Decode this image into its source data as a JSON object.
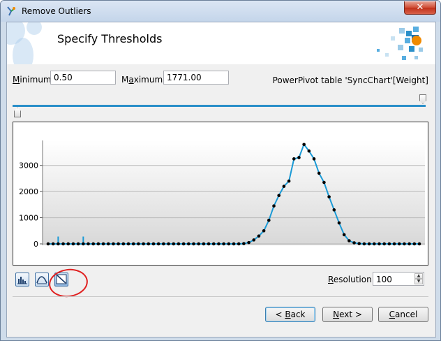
{
  "window": {
    "title": "Remove Outliers",
    "close_glyph": "✕"
  },
  "header": {
    "title": "Specify Thresholds"
  },
  "fields": {
    "minimum": {
      "label_key": "M",
      "label_rest": "inimum:",
      "value": "0.50"
    },
    "maximum": {
      "label_pre": "M",
      "label_key": "a",
      "label_rest": "ximum:",
      "value": "1771.00"
    }
  },
  "table_label": "PowerPivot table 'SyncChart'[Weight]",
  "chart_data": {
    "type": "line",
    "x": [
      1,
      2,
      3,
      4,
      5,
      6,
      7,
      8,
      9,
      10,
      11,
      12,
      13,
      14,
      15,
      16,
      17,
      18,
      19,
      20,
      21,
      22,
      23,
      24,
      25,
      26,
      27,
      28,
      29,
      30,
      31,
      32,
      33,
      34,
      35,
      36,
      37,
      38,
      39,
      40,
      41,
      42,
      43,
      44,
      45,
      46,
      47,
      48,
      49,
      50,
      51,
      52,
      53,
      54,
      55,
      56,
      57,
      58,
      59,
      60,
      61,
      62,
      63,
      64,
      65,
      66,
      67,
      68,
      69,
      70,
      71,
      72,
      73,
      74,
      75
    ],
    "series": [
      {
        "values": [
          0,
          0,
          0,
          0,
          0,
          0,
          0,
          0,
          0,
          0,
          0,
          0,
          0,
          0,
          0,
          0,
          0,
          0,
          0,
          0,
          0,
          0,
          0,
          0,
          0,
          0,
          0,
          0,
          0,
          0,
          0,
          0,
          0,
          0,
          0,
          0,
          0,
          0,
          0,
          10,
          50,
          150,
          300,
          500,
          900,
          1450,
          1850,
          2200,
          2400,
          3250,
          3300,
          3800,
          3550,
          3250,
          2700,
          2350,
          1800,
          1300,
          800,
          350,
          120,
          40,
          10,
          0,
          0,
          0,
          0,
          0,
          0,
          0,
          0,
          0,
          0,
          0,
          0
        ]
      }
    ],
    "spikes": [
      {
        "x": 3,
        "value": 280
      },
      {
        "x": 8,
        "value": 280
      }
    ],
    "yticks": [
      "0",
      "1000",
      "2000",
      "3000"
    ],
    "ylim": [
      0,
      3900
    ],
    "grid": true,
    "colors": {
      "line": "#1a9ad6",
      "marker": "#000000",
      "gradient_bottom": "#d8d8d8"
    }
  },
  "view_buttons": [
    {
      "icon": "histogram-icon"
    },
    {
      "icon": "curve-icon"
    },
    {
      "icon": "distribution-icon",
      "selected": true
    }
  ],
  "resolution": {
    "label_key": "R",
    "label_rest": "esolution:",
    "value": "100"
  },
  "buttons": {
    "back": {
      "pre": "< ",
      "key": "B",
      "rest": "ack"
    },
    "next": {
      "key": "N",
      "rest": "ext >"
    },
    "cancel": {
      "key": "C",
      "rest": "ancel"
    }
  },
  "colors": {
    "accent": "#2a8fc9",
    "annotation": "#e02020"
  }
}
